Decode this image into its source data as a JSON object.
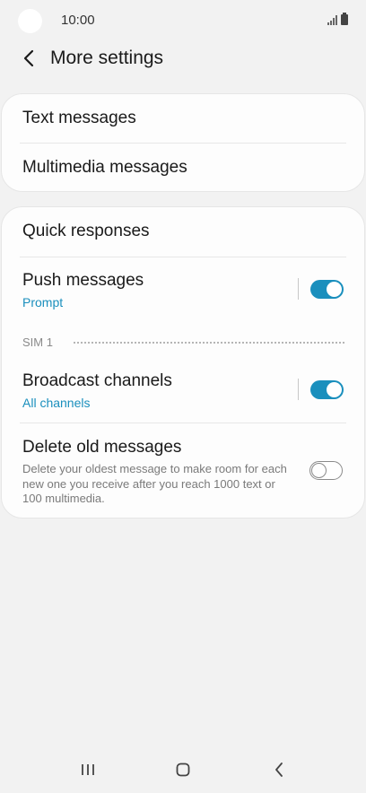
{
  "status_bar": {
    "time": "10:00"
  },
  "header": {
    "title": "More settings"
  },
  "group1": {
    "items": [
      {
        "label": "Text messages"
      },
      {
        "label": "Multimedia messages"
      }
    ]
  },
  "group2": {
    "quick_responses": {
      "label": "Quick responses"
    },
    "push_messages": {
      "label": "Push messages",
      "value": "Prompt",
      "enabled": true
    },
    "sim_section": {
      "label": "SIM 1"
    },
    "broadcast_channels": {
      "label": "Broadcast channels",
      "value": "All channels",
      "enabled": true
    },
    "delete_old_messages": {
      "label": "Delete old messages",
      "description": "Delete your oldest message to make room for each new one you receive after you reach 1000 text or 100 multimedia.",
      "enabled": false
    }
  },
  "colors": {
    "accent": "#1a8fbd",
    "background": "#f2f2f2",
    "card": "#fdfdfd"
  },
  "icons": {
    "back": "back-arrow-icon",
    "signal": "signal-icon",
    "battery": "battery-icon",
    "nav_recents": "recents-icon",
    "nav_home": "home-icon",
    "nav_back": "nav-back-icon"
  }
}
